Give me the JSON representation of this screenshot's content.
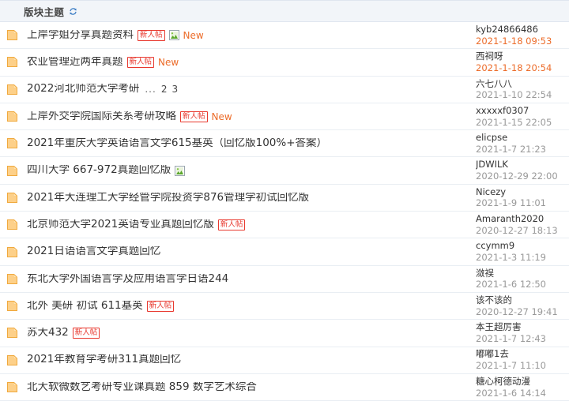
{
  "header": {
    "title": "版块主题",
    "refresh_icon": "refresh-icon"
  },
  "labels": {
    "new_user_badge": "新人帖",
    "new_flag": "New",
    "attachment_icon": "image-attachment-icon",
    "doc_icon": "folder-document-icon",
    "ellipsis": "...",
    "page_2": "2",
    "page_3": "3"
  },
  "colors": {
    "badge_red": "#e8392f",
    "new_orange": "#ec6c2a",
    "date_recent": "#ec6c2a",
    "date_old": "#999999",
    "header_bg": "#f2f5f9",
    "row_border": "#e9eef3",
    "icon_amber": "#f5a623"
  },
  "threads": [
    {
      "title": "上岸学姐分享真题资料",
      "new_user": true,
      "attachment": true,
      "is_new": true,
      "pages": [],
      "author": "kyb24866486",
      "date": "2021-1-18 09:53",
      "date_recent": true
    },
    {
      "title": "农业管理近两年真题",
      "new_user": true,
      "attachment": false,
      "is_new": true,
      "pages": [],
      "author": "西祠呀",
      "date": "2021-1-18 20:54",
      "date_recent": true
    },
    {
      "title": "2022河北师范大学考研",
      "new_user": false,
      "attachment": false,
      "is_new": false,
      "pages": [
        "...",
        "2",
        "3"
      ],
      "author": "六七八八",
      "date": "2021-1-10 22:54",
      "date_recent": false
    },
    {
      "title": "上岸外交学院国际关系考研攻略",
      "new_user": true,
      "attachment": false,
      "is_new": true,
      "pages": [],
      "author": "xxxxxf0307",
      "date": "2021-1-15 22:05",
      "date_recent": false
    },
    {
      "title": "2021年重庆大学英语语言文学615基英（回忆版100%+答案）",
      "new_user": false,
      "attachment": false,
      "is_new": false,
      "pages": [],
      "author": "elicpse",
      "date": "2021-1-7 21:23",
      "date_recent": false
    },
    {
      "title": "四川大学 667-972真题回忆版",
      "new_user": false,
      "attachment": true,
      "is_new": false,
      "pages": [],
      "author": "JDWILK",
      "date": "2020-12-29 22:00",
      "date_recent": false
    },
    {
      "title": "2021年大连理工大学经管学院投资学876管理学初试回忆版",
      "new_user": false,
      "attachment": false,
      "is_new": false,
      "pages": [],
      "author": "Nicezy",
      "date": "2021-1-9 11:01",
      "date_recent": false
    },
    {
      "title": "北京师范大学2021英语专业真题回忆版",
      "new_user": true,
      "attachment": false,
      "is_new": false,
      "pages": [],
      "author": "Amaranth2020",
      "date": "2020-12-27 18:13",
      "date_recent": false
    },
    {
      "title": "2021日语语言文学真题回忆",
      "new_user": false,
      "attachment": false,
      "is_new": false,
      "pages": [],
      "author": "ccymm9",
      "date": "2021-1-3 11:19",
      "date_recent": false
    },
    {
      "title": "东北大学外国语言学及应用语言学日语244",
      "new_user": false,
      "attachment": false,
      "is_new": false,
      "pages": [],
      "author": "潋祦",
      "date": "2021-1-6 12:50",
      "date_recent": false
    },
    {
      "title": "北外 美研 初试 611基英",
      "new_user": true,
      "attachment": false,
      "is_new": false,
      "pages": [],
      "author": "该不该的",
      "date": "2020-12-27 19:41",
      "date_recent": false
    },
    {
      "title": "苏大432",
      "new_user": true,
      "attachment": false,
      "is_new": false,
      "pages": [],
      "author": "本王超厉害",
      "date": "2021-1-7 12:43",
      "date_recent": false
    },
    {
      "title": "2021年教育学考研311真题回忆",
      "new_user": false,
      "attachment": false,
      "is_new": false,
      "pages": [],
      "author": "嘟嘟1去",
      "date": "2021-1-7 11:10",
      "date_recent": false
    },
    {
      "title": "北大软微数艺考研专业课真题 859 数字艺术综合",
      "new_user": false,
      "attachment": false,
      "is_new": false,
      "pages": [],
      "author": "糖心柯德动漫",
      "date": "2021-1-6 14:14",
      "date_recent": false
    }
  ]
}
